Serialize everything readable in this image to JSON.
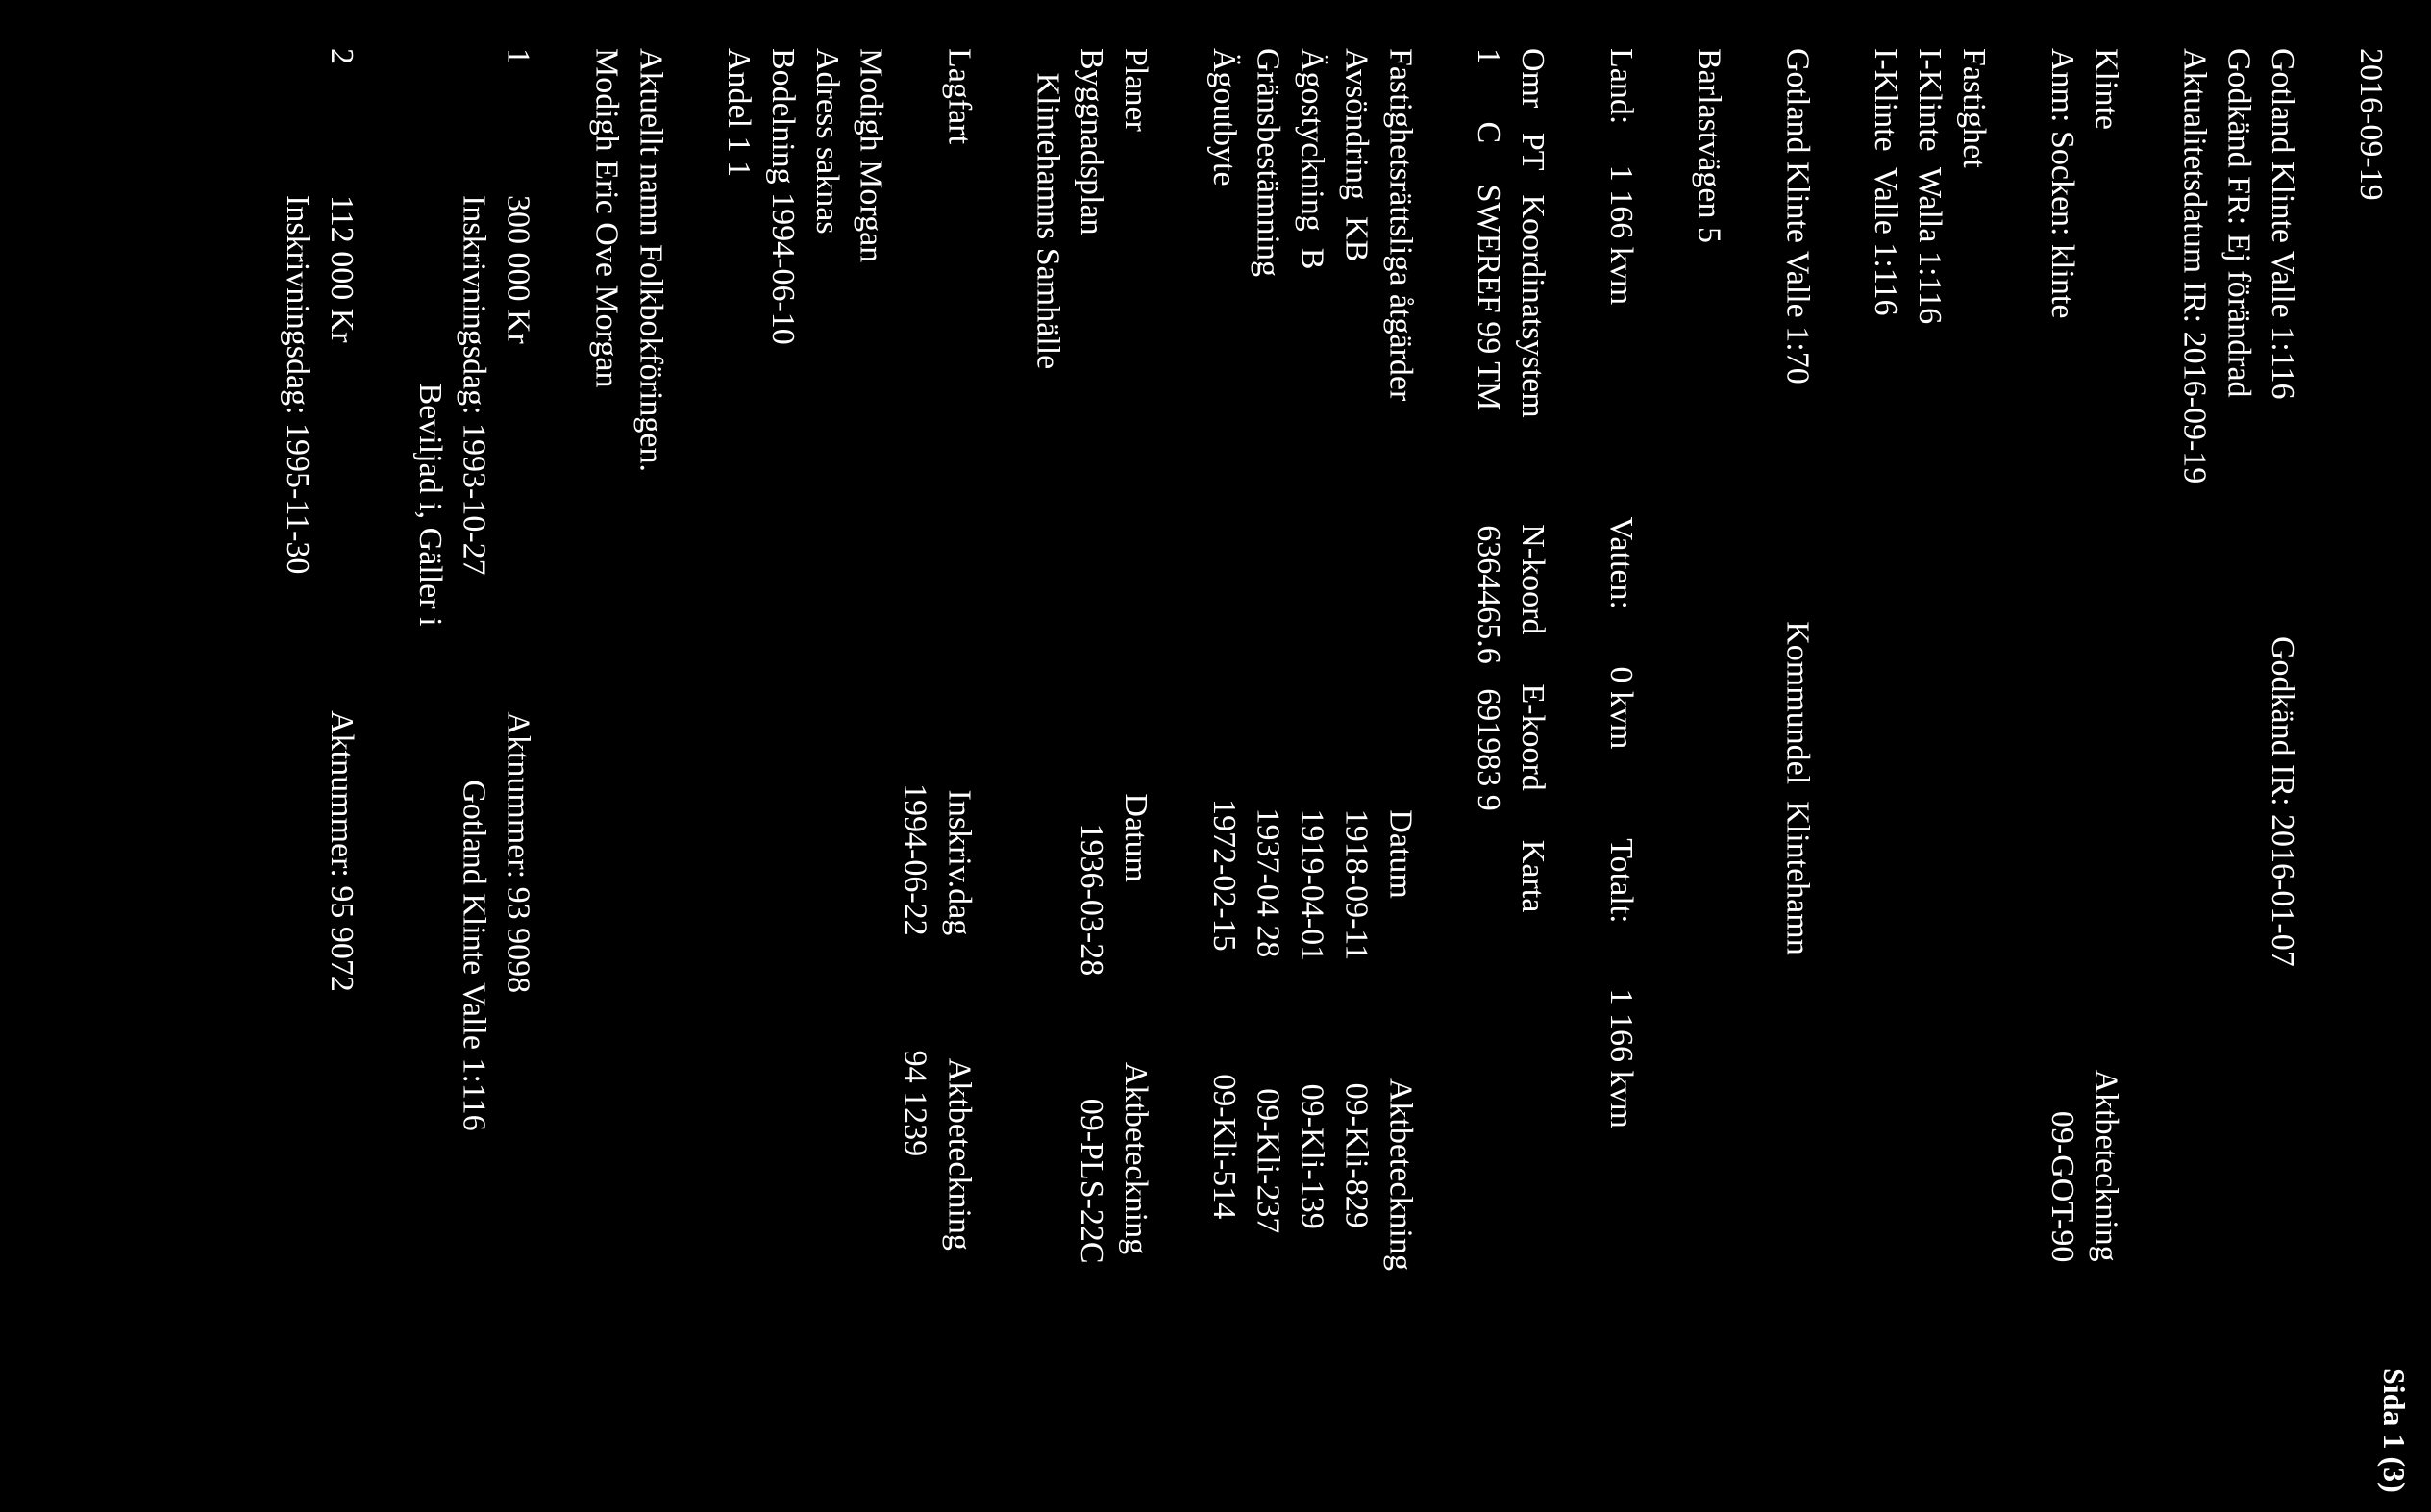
{
  "top_date": "2016-09-19",
  "header": {
    "line1_left": "Gotland Klinte Valle 1:116",
    "line1_right": "Godkänd IR: 2016-01-07",
    "line2": "Godkänd FR: Ej förändrad",
    "line3": "Aktualitetsdatum IR: 2016-09-19"
  },
  "socken_line1": "Klinte",
  "socken_line2": "Anm: Socken: klinte",
  "akt_heading": "Aktbeteckning",
  "akt_value": "09-GOT-90",
  "fastighet_heading": "Fastighet",
  "fastighet_line1": "I-Klinte  Walla 1:116",
  "fastighet_line2": "I-Klinte  Valle 1:116",
  "gotland_line": "Gotland Klinte Valle 1:70",
  "kommundel_label": "Kommundel  Klintehamn",
  "adress_label": "Barlastvägen 5",
  "land_line": "Land:     1 166 kvm                          Vatten:       0 kvm           Totalt:        1 166 kvm",
  "omr_header": "Omr   PT   Koordinatsystem             N-koord      E-koord      Karta",
  "omr_row": "1       C     SWEREF 99 TM              6364465.6   691983 9",
  "atgard_heading": "Fastighetsrättsliga åtgärder",
  "atgard_datum": "Datum",
  "atgard_akt": "Aktbeteckning",
  "atgard_rows": [
    {
      "label": "Avsöndring  KB",
      "datum": "1918-09-11",
      "akt": "09-Kli-829"
    },
    {
      "label": "Ägostyckning  B",
      "datum": "1919-04-01",
      "akt": "09-Kli-139"
    },
    {
      "label": "Gränsbestämning",
      "datum": "1937-04 28",
      "akt": "09-Kli-237"
    },
    {
      "label": "Ägoutbyte",
      "datum": "1972-02-15",
      "akt": "09-Kli-514"
    }
  ],
  "planer_heading": "Planer",
  "planer_datum": "Datum",
  "planer_akt": "Aktbeteckning",
  "planer_row_label": "Byggnadsplan",
  "planer_row_sub": "   Klintehamns Samhälle",
  "planer_row_datum": "1936-03-28",
  "planer_row_akt": "09-PLS-22C",
  "lagfart_heading": "Lagfart",
  "lagfart_inskriv": "Inskriv.dag",
  "lagfart_akt": "Aktbeteckning",
  "lagfart_date": "1994-06-22",
  "lagfart_aktval": "94 1239",
  "owner_name": "Modigh Morgan",
  "owner_addr": "Adress saknas",
  "owner_bodel": "Bodelning 1994-06-10",
  "owner_andel": "Andel 1 1",
  "aktuellt": "Aktuellt namn Folkbokföringen.",
  "aktuellt_name": "Modigh Eric Ove Morgan",
  "entry1_num": "1",
  "entry1_amount": "300 000 Kr",
  "entry1_aktnum": "Aktnummer: 93 9098",
  "entry1_date": "Inskrivningsdag: 1993-10-27",
  "entry1_ref": "Gotland Klinte Valle 1:116",
  "entry1_status": "Beviljad i, Gäller i",
  "entry2_num": "2",
  "entry2_amount": "112 000 Kr",
  "entry2_aktnum": "Aktnummer: 95 9072",
  "entry2_date": "Inskrivningsdag: 1995-11-30",
  "footer": "Sida 1 (3)"
}
